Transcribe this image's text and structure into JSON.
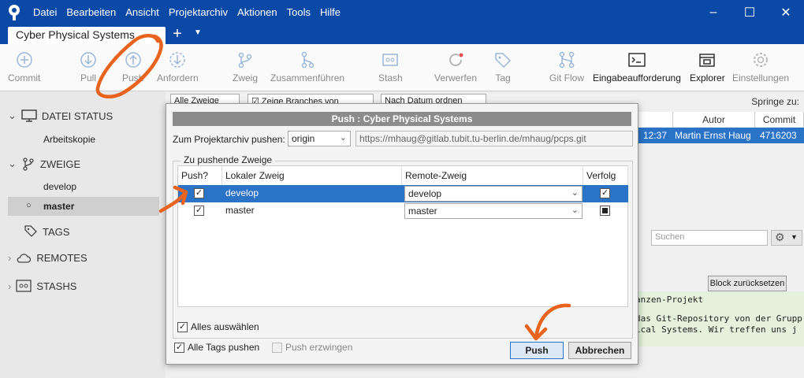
{
  "app": {
    "menu": [
      "Datei",
      "Bearbeiten",
      "Ansicht",
      "Projektarchiv",
      "Aktionen",
      "Tools",
      "Hilfe"
    ],
    "tab_title": "Cyber Physical Systems"
  },
  "toolbar": {
    "commit": "Commit",
    "pull": "Pull",
    "push": "Push",
    "fetch": "Anfordern",
    "branch": "Zweig",
    "merge": "Zusammenführen",
    "stash": "Stash",
    "discard": "Verwerfen",
    "tag": "Tag",
    "gitflow": "Git Flow",
    "terminal": "Eingabeaufforderung",
    "explorer": "Explorer",
    "settings": "Einstellungen"
  },
  "sidebar": {
    "file_status": "DATEI STATUS",
    "working_copy": "Arbeitskopie",
    "branches": "ZWEIGE",
    "branch_develop": "develop",
    "branch_master": "master",
    "tags": "TAGS",
    "remotes": "REMOTES",
    "stashes": "STASHS"
  },
  "background": {
    "filter_branches": "Alle Zweige",
    "show_remote": "Zeige Branches von Remote",
    "sort": "Nach Datum ordnen",
    "jump_to": "Springe zu:",
    "col_author": "Autor",
    "col_commit": "Commit",
    "row_time": "12:37",
    "row_author": "Martin Ernst Haug",
    "row_commit": "4716203",
    "search_placeholder": "Suchen",
    "reset_block": "Block zurücksetzen",
    "code_line1": "anzen-Projekt",
    "code_line2": "das Git-Repository von der Grupp",
    "code_line3": "ical Systems. Wir treffen uns j"
  },
  "dialog": {
    "title": "Push : Cyber Physical Systems",
    "repo_label": "Zum Projektarchiv pushen:",
    "repo_value": "origin",
    "repo_url": "https://mhaug@gitlab.tubit.tu-berlin.de/mhaug/pcps.git",
    "group_title": "Zu pushende Zweige",
    "col_push": "Push?",
    "col_local": "Lokaler Zweig",
    "col_remote": "Remote-Zweig",
    "col_track": "Verfolg",
    "rows": [
      {
        "local": "develop",
        "remote": "develop"
      },
      {
        "local": "master",
        "remote": "master"
      }
    ],
    "select_all": "Alles auswählen",
    "push_all_tags": "Alle Tags pushen",
    "force_push": "Push erzwingen",
    "push_button": "Push",
    "cancel_button": "Abbrechen"
  },
  "colors": {
    "titlebar": "#0a4aa6",
    "selection": "#2b73c6",
    "annotation": "#e8641e"
  }
}
